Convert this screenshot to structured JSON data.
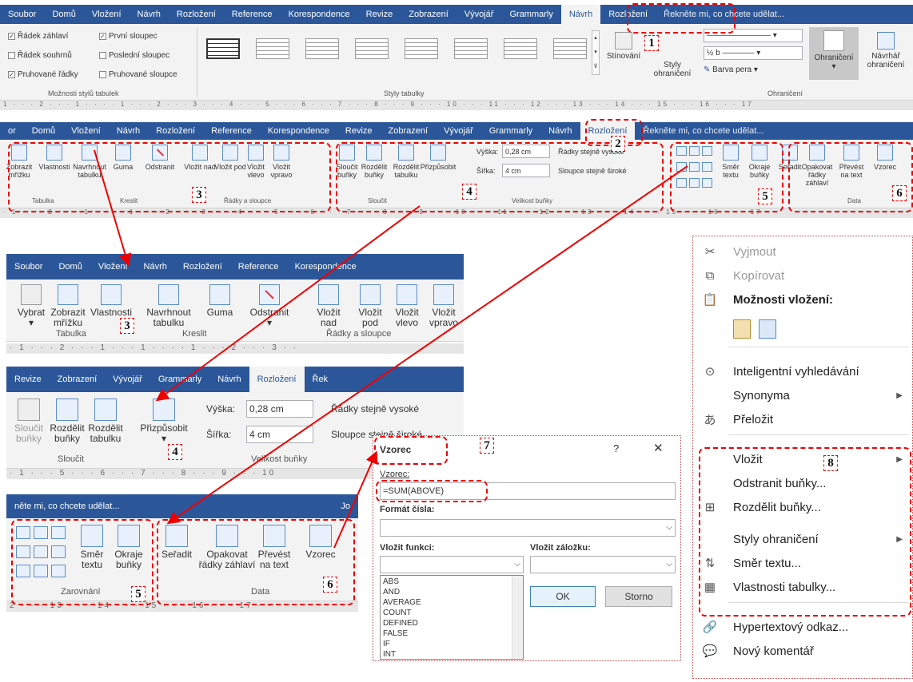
{
  "strip1": {
    "tabs": [
      "Soubor",
      "Domů",
      "Vložení",
      "Návrh",
      "Rozložení",
      "Reference",
      "Korespondence",
      "Revize",
      "Zobrazení",
      "Vývojář",
      "Grammarly",
      "Návrh",
      "Rozložení"
    ],
    "tell_me": "Řekněte mi, co chcete udělat...",
    "checkboxes": [
      {
        "label": "Řádek záhlaví",
        "checked": true
      },
      {
        "label": "První sloupec",
        "checked": true
      },
      {
        "label": "Řádek souhrnů",
        "checked": false
      },
      {
        "label": "Poslední sloupec",
        "checked": false
      },
      {
        "label": "Pruhované řádky",
        "checked": true
      },
      {
        "label": "Pruhované sloupce",
        "checked": false
      }
    ],
    "group_options": "Možnosti stylů tabulek",
    "group_styles": "Styly tabulky",
    "shading": "Stínování",
    "border_styles": "Styly ohraničení",
    "pen_weight": "½ b",
    "pen_color": "Barva pera",
    "borders": "Ohraničení",
    "border_painter": "Návrhář ohraničení",
    "group_borders": "Ohraničení",
    "ruler": "1 · · · 2 · · · 1 · · · · 1 · · · 2 · · · 3 · · · 4 · · · 5 · · · 6 · · · 7 · · · 8 · · · 9 · · · 10 · · · 11 · · · 12 · · · 13 · · · 14 · · · 15 · · · 16 · · · 17"
  },
  "strip2": {
    "tabs": [
      "or",
      "Domů",
      "Vložení",
      "Návrh",
      "Rozložení",
      "Reference",
      "Korespondence",
      "Revize",
      "Zobrazení",
      "Vývojář",
      "Grammarly",
      "Návrh",
      "Rozložení"
    ],
    "tell_me": "Řekněte mi, co chcete udělat...",
    "buttons": [
      "Zobrazit mřížku",
      "Vlastnosti",
      "Navrhnout tabulku",
      "Guma",
      "Odstranit",
      "Vložit nad",
      "Vložit pod",
      "Vložit vlevo",
      "Vložit vpravo",
      "Sloučit buňky",
      "Rozdělit buňky",
      "Rozdělit tabulku",
      "Přizpůsobit",
      "Směr textu",
      "Okraje buňky",
      "Seřadit",
      "Opakovat řádky záhlaví",
      "Převést na text",
      "Vzorec"
    ],
    "height_label": "Výška:",
    "height_value": "0,28 cm",
    "width_label": "Šířka:",
    "width_value": "4 cm",
    "rows_equal": "Řádky stejně vysoké",
    "cols_equal": "Sloupce stejně široké",
    "groups": [
      "Tabulka",
      "Kreslit",
      "Řádky a sloupce",
      "Sloučit",
      "Velikost buňky",
      "Data"
    ],
    "ruler": "· 1 · · · 2 · · · 1 · · · · 1 · · · 2 · · · 3 · · · 4 · · · 5 · · · 6 · · · 7 · · · 8 · · · 9 · · · 10 · · · 11 · · · 12 · · · 13 · · · 14 · · · 15 · · · 16 · · · 17"
  },
  "zoom3": {
    "tabs": [
      "Soubor",
      "Domů",
      "Vložení",
      "Návrh",
      "Rozložení",
      "Reference",
      "Korespondence"
    ],
    "buttons": [
      {
        "label": "Vybrat",
        "sub": "▾"
      },
      {
        "label": "Zobrazit",
        "sub": "mřížku"
      },
      {
        "label": "Vlastnosti",
        "sub": ""
      },
      {
        "label": "Navrhnout",
        "sub": "tabulku"
      },
      {
        "label": "Guma",
        "sub": ""
      },
      {
        "label": "Odstranit",
        "sub": "▾"
      },
      {
        "label": "Vložit",
        "sub": "nad"
      },
      {
        "label": "Vložit",
        "sub": "pod"
      },
      {
        "label": "Vložit",
        "sub": "vlevo"
      },
      {
        "label": "Vložit",
        "sub": "vpravo"
      }
    ],
    "groups": [
      "Tabulka",
      "Kreslit",
      "Řádky a sloupce"
    ],
    "ruler": "· 1 · · · 2 · · · 1 · · · 1 · · · · 1 · · · 2 · · · 3 · ·"
  },
  "zoom4": {
    "tabs": [
      "Revize",
      "Zobrazení",
      "Vývojář",
      "Grammarly",
      "Návrh",
      "Rozložení",
      "Řek"
    ],
    "buttons": [
      {
        "label": "Sloučit",
        "sub": "buňky"
      },
      {
        "label": "Rozdělit",
        "sub": "buňky"
      },
      {
        "label": "Rozdělit",
        "sub": "tabulku"
      },
      {
        "label": "Přizpůsobit",
        "sub": "▾"
      }
    ],
    "height_label": "Výška:",
    "height_value": "0,28 cm",
    "width_label": "Šířka:",
    "width_value": "4 cm",
    "rows_equal": "Řádky stejně vysoké",
    "cols_equal": "Sloupce stejně široké",
    "groups": [
      "Sloučit",
      "Velikost buňky"
    ],
    "ruler": "· 1 · · · 5 · · · 6 · · · 7 · · · 8 · · · 9 · · · 10"
  },
  "zoom56": {
    "tell_me": "něte mi, co chcete udělat...",
    "right_tab": "Jo",
    "buttons": [
      {
        "label": "Směr",
        "sub": "textu"
      },
      {
        "label": "Okraje",
        "sub": "buňky"
      },
      {
        "label": "Seřadit",
        "sub": ""
      },
      {
        "label": "Opakovat",
        "sub": "řádky záhlaví"
      },
      {
        "label": "Převést",
        "sub": "na text"
      },
      {
        "label": "Vzorec",
        "sub": ""
      }
    ],
    "groups": [
      "Zarovnání",
      "Data"
    ],
    "ruler": "2 · · · 13 · · · 14 · · · 15 · · · 16 · · · 17 · ·"
  },
  "dialog": {
    "title": "Vzorec",
    "help": "?",
    "close": "✕",
    "formula_label": "Vzorec:",
    "formula_value": "=SUM(ABOVE)",
    "format_label": "Formát čísla:",
    "function_label": "Vložit funkci:",
    "bookmark_label": "Vložit záložku:",
    "ok": "OK",
    "cancel": "Storno",
    "functions": [
      "ABS",
      "AND",
      "AVERAGE",
      "COUNT",
      "DEFINED",
      "FALSE",
      "IF",
      "INT"
    ]
  },
  "menu": {
    "items": [
      {
        "icon": "scissors-icon",
        "glyph": "✂",
        "label": "Vyjmout",
        "disabled": true,
        "arrow": false
      },
      {
        "icon": "copy-icon",
        "glyph": "⧉",
        "label": "Kopírovat",
        "disabled": true,
        "arrow": false
      },
      {
        "icon": "paste-icon",
        "glyph": "📋",
        "label": "Možnosti vložení:",
        "disabled": false,
        "arrow": false,
        "bold": true
      },
      {
        "icon": "smart-lookup-icon",
        "glyph": "⊙",
        "label": "Inteligentní vyhledávání",
        "disabled": false,
        "arrow": false
      },
      {
        "icon": "",
        "glyph": "",
        "label": "Synonyma",
        "disabled": false,
        "arrow": true
      },
      {
        "icon": "translate-icon",
        "glyph": "あ",
        "label": "Přeložit",
        "disabled": false,
        "arrow": false
      },
      {
        "icon": "",
        "glyph": "",
        "label": "Vložit",
        "disabled": false,
        "arrow": true
      },
      {
        "icon": "",
        "glyph": "",
        "label": "Odstranit buňky...",
        "disabled": false,
        "arrow": false
      },
      {
        "icon": "split-cells-icon",
        "glyph": "⊞",
        "label": "Rozdělit buňky...",
        "disabled": false,
        "arrow": false
      },
      {
        "icon": "",
        "glyph": "",
        "label": "Styly ohraničení",
        "disabled": false,
        "arrow": true
      },
      {
        "icon": "text-direction-icon",
        "glyph": "⇅",
        "label": "Směr textu...",
        "disabled": false,
        "arrow": false
      },
      {
        "icon": "table-properties-icon",
        "glyph": "▦",
        "label": "Vlastnosti tabulky...",
        "disabled": false,
        "arrow": false
      },
      {
        "icon": "hyperlink-icon",
        "glyph": "🔗",
        "label": "Hypertextový odkaz...",
        "disabled": false,
        "arrow": false
      },
      {
        "icon": "new-comment-icon",
        "glyph": "💬",
        "label": "Nový komentář",
        "disabled": false,
        "arrow": false
      }
    ]
  },
  "markers": [
    "1",
    "2",
    "3",
    "3",
    "4",
    "4",
    "5",
    "5",
    "6",
    "6",
    "7",
    "8"
  ]
}
